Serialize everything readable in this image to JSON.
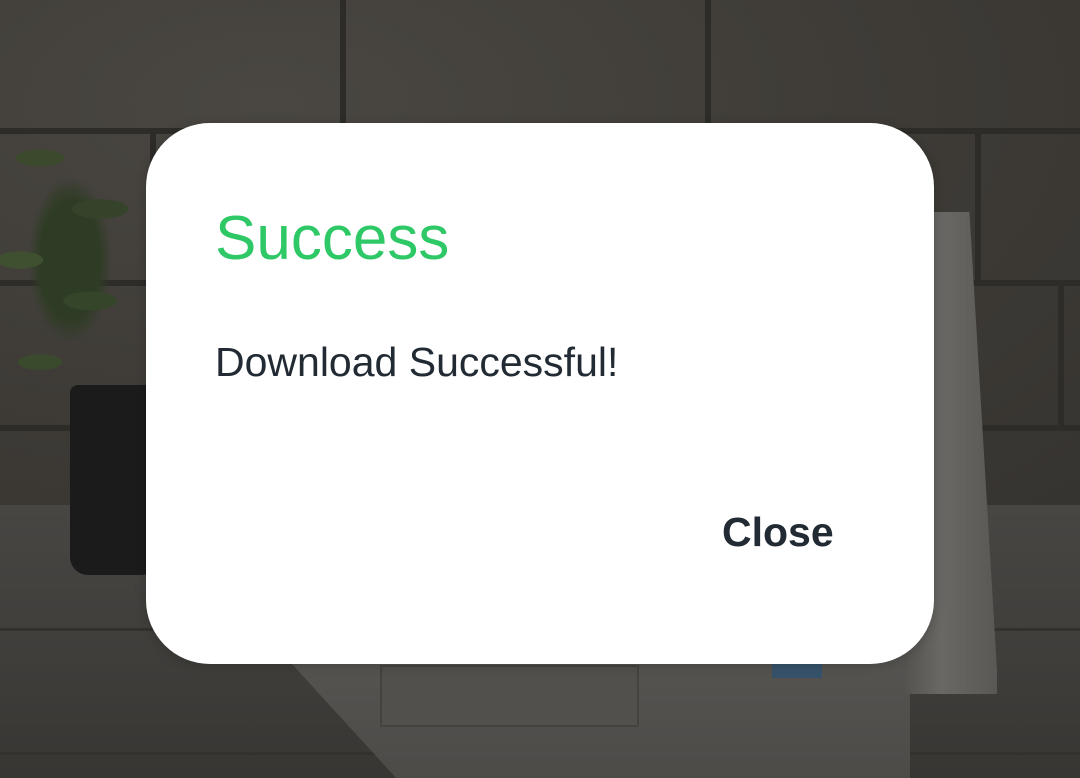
{
  "dialog": {
    "title": "Success",
    "message": "Download Successful!",
    "close_label": "Close"
  },
  "colors": {
    "title": "#2ec866",
    "message_text": "#222b33",
    "button_text": "#222b33",
    "dialog_background": "#ffffff",
    "scrim": "#3a3835"
  },
  "backdrop": {
    "description_icons": [
      "potted-plant",
      "laptop",
      "brick-wall"
    ]
  }
}
